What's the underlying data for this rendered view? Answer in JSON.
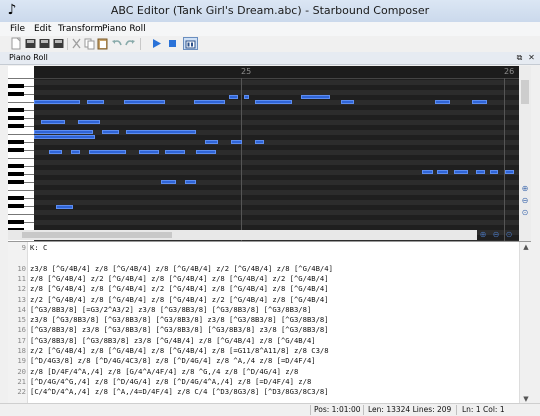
{
  "window": {
    "title": "ABC Editor (Tank Girl's Dream.abc) - Starbound Composer",
    "icon": "music-note-icon"
  },
  "menu": [
    "File",
    "Edit",
    "Transform",
    "Piano Roll"
  ],
  "toolbar": {
    "buttons": [
      "new-file-icon",
      "open-icon",
      "save-icon",
      "save-all-icon",
      "cut-icon",
      "copy-icon",
      "paste-icon",
      "undo-icon",
      "redo-icon",
      "play-icon",
      "stop-icon",
      "piano-roll-toggle-icon"
    ]
  },
  "piano_roll": {
    "title": "Piano Roll",
    "ruler": [
      "25",
      "26"
    ],
    "notes": [
      {
        "start": 0.0,
        "end": 2.1,
        "row": 4
      },
      {
        "start": 2.4,
        "end": 3.2,
        "row": 4
      },
      {
        "start": 4.1,
        "end": 6.0,
        "row": 4
      },
      {
        "start": 7.3,
        "end": 8.7,
        "row": 4
      },
      {
        "start": 8.9,
        "end": 9.3,
        "row": 3
      },
      {
        "start": 9.6,
        "end": 9.8,
        "row": 3
      },
      {
        "start": 10.1,
        "end": 11.8,
        "row": 4
      },
      {
        "start": 12.2,
        "end": 13.5,
        "row": 3
      },
      {
        "start": 14.0,
        "end": 14.6,
        "row": 4
      },
      {
        "start": 18.3,
        "end": 19.0,
        "row": 4
      },
      {
        "start": 20.0,
        "end": 20.7,
        "row": 4
      },
      {
        "start": 0.3,
        "end": 1.4,
        "row": 8
      },
      {
        "start": 2.0,
        "end": 3.0,
        "row": 8
      },
      {
        "start": 0.0,
        "end": 2.7,
        "row": 10
      },
      {
        "start": 3.1,
        "end": 3.9,
        "row": 10
      },
      {
        "start": 4.2,
        "end": 7.4,
        "row": 10
      },
      {
        "start": 0.0,
        "end": 2.8,
        "row": 11
      },
      {
        "start": 7.8,
        "end": 8.4,
        "row": 12
      },
      {
        "start": 9.0,
        "end": 9.5,
        "row": 12
      },
      {
        "start": 10.1,
        "end": 10.5,
        "row": 12
      },
      {
        "start": 0.7,
        "end": 1.3,
        "row": 14
      },
      {
        "start": 1.7,
        "end": 2.1,
        "row": 14
      },
      {
        "start": 2.5,
        "end": 4.2,
        "row": 14
      },
      {
        "start": 4.8,
        "end": 5.7,
        "row": 14
      },
      {
        "start": 6.0,
        "end": 6.9,
        "row": 14
      },
      {
        "start": 7.4,
        "end": 8.3,
        "row": 14
      },
      {
        "start": 17.7,
        "end": 18.2,
        "row": 18
      },
      {
        "start": 18.4,
        "end": 18.9,
        "row": 18
      },
      {
        "start": 19.2,
        "end": 19.8,
        "row": 18
      },
      {
        "start": 20.2,
        "end": 20.6,
        "row": 18
      },
      {
        "start": 20.8,
        "end": 21.2,
        "row": 18
      },
      {
        "start": 21.5,
        "end": 21.9,
        "row": 18
      },
      {
        "start": 5.8,
        "end": 6.5,
        "row": 20
      },
      {
        "start": 6.9,
        "end": 7.4,
        "row": 20
      },
      {
        "start": 1.0,
        "end": 1.8,
        "row": 25
      }
    ],
    "zoom_buttons": [
      "zoom-in-icon",
      "zoom-out-icon",
      "zoom-reset-icon"
    ]
  },
  "editor": {
    "lines": [
      {
        "n": "9",
        "text": "K: C"
      },
      {
        "n": "",
        "text": ""
      },
      {
        "n": "10",
        "text": "z3/8 [^G/4B/4] z/8 [^G/4B/4] z/8 [^G/4B/4] z/2 [^G/4B/4] z/8 [^G/4B/4]"
      },
      {
        "n": "11",
        "text": "z/8 [^G/4B/4] z/2 [^G/4B/4] z/8 [^G/4B/4] z/8 [^G/4B/4] z/2 [^G/4B/4]"
      },
      {
        "n": "12",
        "text": "z/8 [^G/4B/4] z/8 [^G/4B/4] z/2 [^G/4B/4] z/8 [^G/4B/4] z/8 [^G/4B/4]"
      },
      {
        "n": "13",
        "text": "z/2 [^G/4B/4] z/8 [^G/4B/4] z/8 [^G/4B/4] z/2 [^G/4B/4] z/8 [^G/4B/4]"
      },
      {
        "n": "14",
        "text": "[^G3/8B3/8] [=G3/2^A3/2] z3/8 [^G3/8B3/8] [^G3/8B3/8] [^G3/8B3/8]"
      },
      {
        "n": "15",
        "text": "z3/8 [^G3/8B3/8] [^G3/8B3/8] [^G3/8B3/8] z3/8 [^G3/8B3/8] [^G3/8B3/8]"
      },
      {
        "n": "16",
        "text": "[^G3/8B3/8] z3/8 [^G3/8B3/8] [^G3/8B3/8] [^G3/8B3/8] z3/8 [^G3/8B3/8]"
      },
      {
        "n": "17",
        "text": "[^G3/8B3/8] [^G3/8B3/8] z3/8 [^G/4B/4] z/8 [^G/4B/4] z/8 [^G/4B/4]"
      },
      {
        "n": "18",
        "text": "z/2 [^G/4B/4] z/8 [^G/4B/4] z/8 [^G/4B/4] z/8 [=G11/8^A11/8] z/8 C3/8"
      },
      {
        "n": "19",
        "text": "[^D/4G3/8] z/8 [^D/4G/4C3/8] z/8 [^D/4G/4] z/8 ^A,/4 z/8 [=D/4F/4]"
      },
      {
        "n": "20",
        "text": "z/8 [D/4F/4^A,/4] z/8 [G/4^A/4F/4] z/8 ^G,/4 z/8 [^D/4G/4] z/8"
      },
      {
        "n": "21",
        "text": "[^D/4G/4^G,/4] z/8 [^D/4G/4] z/8 [^D/4G/4^A,/4] z/8 [=D/4F/4] z/8"
      },
      {
        "n": "22",
        "text": "[C/4^D/4^A,/4] z/8 [^A,/4=D/4F/4] z/8 C/4 [^D3/8G3/8] [^D3/8G3/8C3/8]"
      }
    ]
  },
  "status": {
    "pos": "Pos: 1:01:00",
    "len": "Len: 13324 Lines: 209",
    "ln": "Ln: 1 Col: 1"
  }
}
